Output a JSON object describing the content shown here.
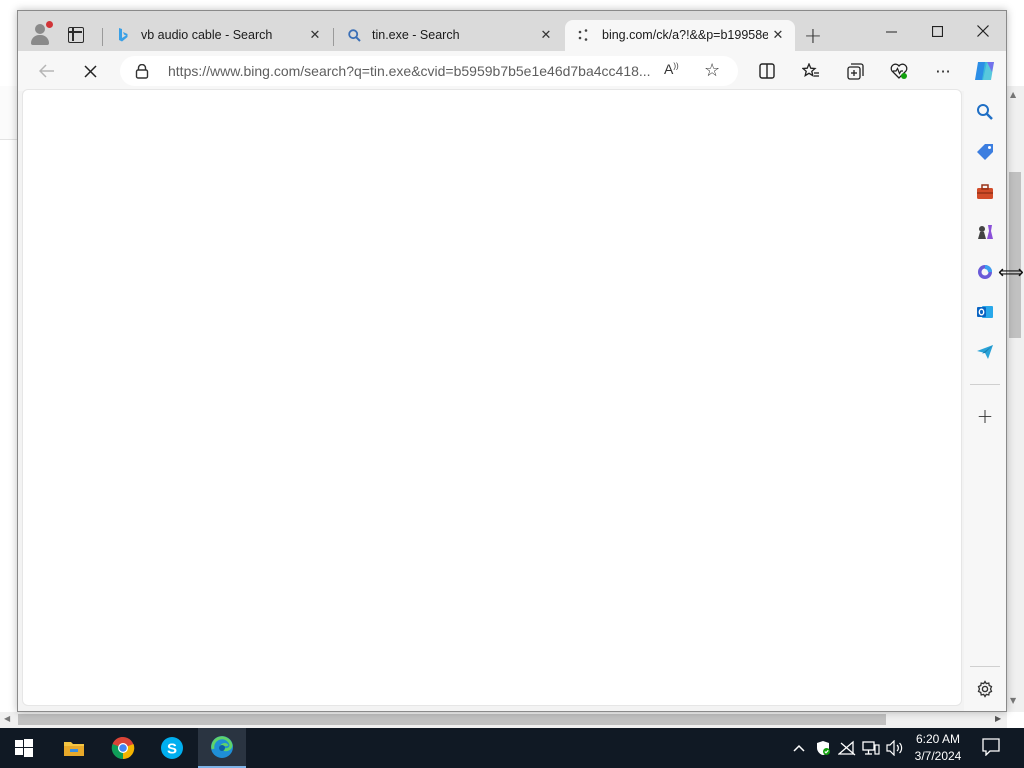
{
  "window": {
    "tabs": [
      {
        "title": "vb audio cable - Search",
        "favicon": "bing-icon",
        "active": false
      },
      {
        "title": "tin.exe - Search",
        "favicon": "search-icon",
        "active": false
      },
      {
        "title": "bing.com/ck/a?!&&p=b19958e",
        "favicon": "loading-icon",
        "active": true
      }
    ],
    "controls": {
      "minimize": "—",
      "maximize": "☐",
      "close": "✕"
    }
  },
  "toolbar": {
    "url_host": "https://www.bing.com",
    "url_path": "/search?q=tin.exe&cvid=b5959b7b5e1e46d7ba4cc418...",
    "read_aloud": "Â",
    "icons": [
      "back-icon",
      "stop-icon",
      "split-screen-icon",
      "favorites-icon",
      "collections-icon",
      "browser-essentials-icon",
      "more-icon",
      "copilot-icon"
    ]
  },
  "sidebar": {
    "icons": [
      "search-icon",
      "shopping-icon",
      "tools-icon",
      "games-icon",
      "microsoft365-icon",
      "outlook-icon",
      "drop-icon",
      "add-icon",
      "settings-icon"
    ]
  },
  "taskbar": {
    "apps": [
      "start-icon",
      "file-explorer-icon",
      "chrome-icon",
      "skype-icon",
      "edge-icon"
    ],
    "time": "6:20 AM",
    "date": "3/7/2024"
  },
  "colors": {
    "accent": "#0078d4",
    "taskbar": "#101924",
    "titlebar": "#dadada"
  }
}
